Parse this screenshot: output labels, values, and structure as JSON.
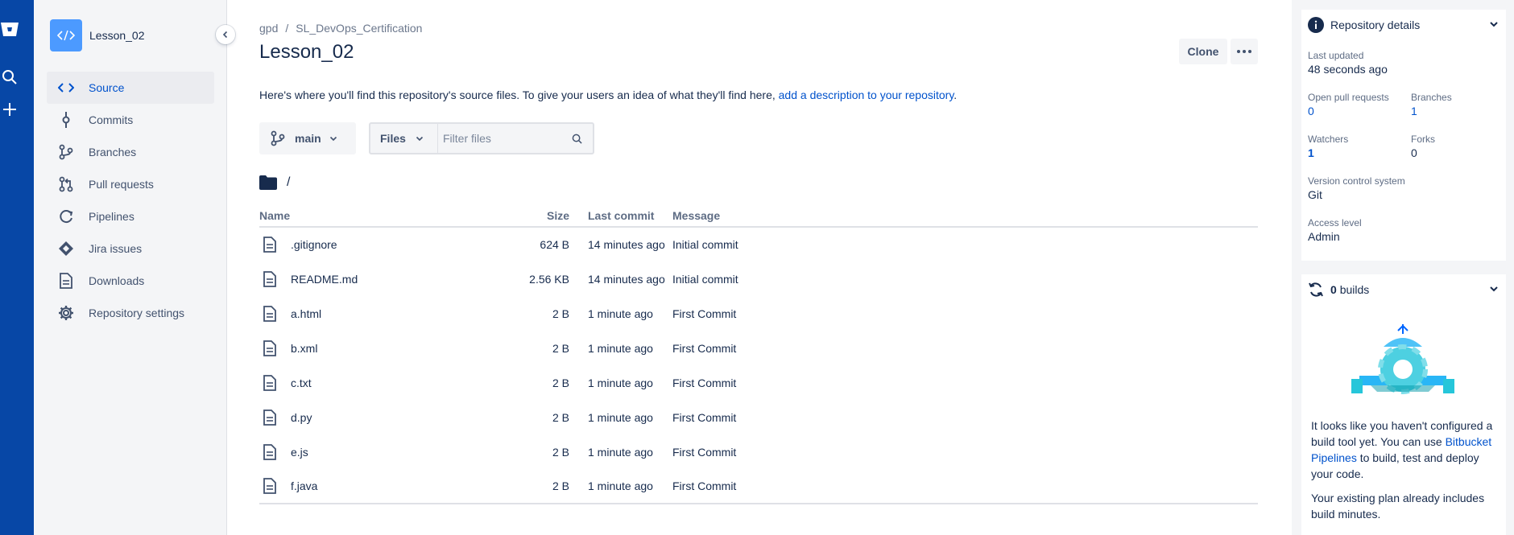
{
  "repo": {
    "name": "Lesson_02",
    "workspace": "gpd",
    "project": "SL_DevOps_Certification",
    "title": "Lesson_02"
  },
  "sidebar": {
    "items": [
      {
        "label": "Source",
        "icon": "code-icon",
        "active": true
      },
      {
        "label": "Commits",
        "icon": "commit-icon",
        "active": false
      },
      {
        "label": "Branches",
        "icon": "branch-icon",
        "active": false
      },
      {
        "label": "Pull requests",
        "icon": "pull-request-icon",
        "active": false
      },
      {
        "label": "Pipelines",
        "icon": "pipelines-icon",
        "active": false
      },
      {
        "label": "Jira issues",
        "icon": "jira-icon",
        "active": false
      },
      {
        "label": "Downloads",
        "icon": "downloads-icon",
        "active": false
      },
      {
        "label": "Repository settings",
        "icon": "settings-icon",
        "active": false
      }
    ]
  },
  "header": {
    "clone_label": "Clone",
    "description_prefix": "Here's where you'll find this repository's source files. To give your users an idea of what they'll find here,",
    "description_link": "add a description to your repository",
    "description_suffix": "."
  },
  "toolbar": {
    "branch": "main",
    "files_label": "Files",
    "filter_placeholder": "Filter files"
  },
  "path": "/",
  "table": {
    "headers": {
      "name": "Name",
      "size": "Size",
      "last_commit": "Last commit",
      "message": "Message"
    },
    "rows": [
      {
        "name": ".gitignore",
        "size": "624 B",
        "last_commit": "14 minutes ago",
        "message": "Initial commit"
      },
      {
        "name": "README.md",
        "size": "2.56 KB",
        "last_commit": "14 minutes ago",
        "message": "Initial commit"
      },
      {
        "name": "a.html",
        "size": "2 B",
        "last_commit": "1 minute ago",
        "message": "First Commit"
      },
      {
        "name": "b.xml",
        "size": "2 B",
        "last_commit": "1 minute ago",
        "message": "First Commit"
      },
      {
        "name": "c.txt",
        "size": "2 B",
        "last_commit": "1 minute ago",
        "message": "First Commit"
      },
      {
        "name": "d.py",
        "size": "2 B",
        "last_commit": "1 minute ago",
        "message": "First Commit"
      },
      {
        "name": "e.js",
        "size": "2 B",
        "last_commit": "1 minute ago",
        "message": "First Commit"
      },
      {
        "name": "f.java",
        "size": "2 B",
        "last_commit": "1 minute ago",
        "message": "First Commit"
      }
    ]
  },
  "details": {
    "title": "Repository details",
    "last_updated_label": "Last updated",
    "last_updated_value": "48 seconds ago",
    "open_prs_label": "Open pull requests",
    "open_prs_value": "0",
    "branches_label": "Branches",
    "branches_value": "1",
    "watchers_label": "Watchers",
    "watchers_value": "1",
    "forks_label": "Forks",
    "forks_value": "0",
    "vcs_label": "Version control system",
    "vcs_value": "Git",
    "access_label": "Access level",
    "access_value": "Admin"
  },
  "builds": {
    "count": "0",
    "label": "builds",
    "text_prefix": "It looks like you haven't configured a build tool yet. You can use",
    "link": "Bitbucket Pipelines",
    "text_suffix": "to build, test and deploy your code.",
    "plan_text": "Your existing plan already includes build minutes."
  },
  "colors": {
    "global_bar": "#0747a6",
    "link": "#0052cc",
    "sidebar_bg": "#f4f5f7"
  }
}
